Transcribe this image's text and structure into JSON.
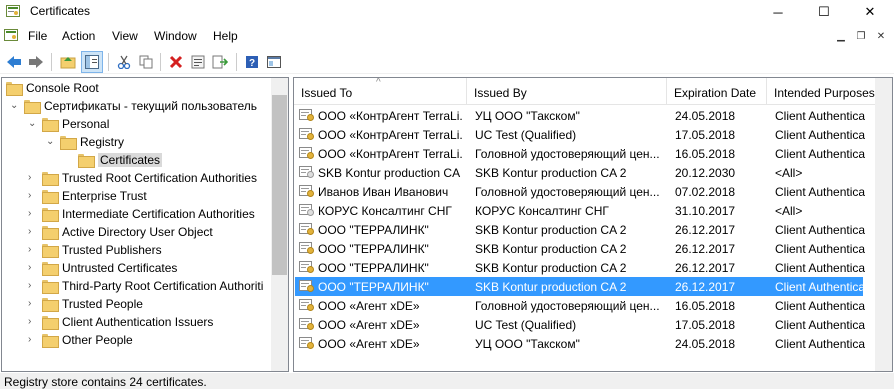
{
  "window": {
    "title": "Certificates",
    "minimize": "─",
    "maximize": "☐",
    "close": "✕"
  },
  "menu": {
    "items": [
      "File",
      "Action",
      "View",
      "Window",
      "Help"
    ],
    "mdi": [
      "▁",
      "❐",
      "✕"
    ]
  },
  "toolbar": {
    "icons": [
      "back-icon",
      "forward-icon",
      "up-folder-icon",
      "show-hide-tree-icon",
      "cut-icon",
      "copy-icon",
      "delete-icon",
      "properties-icon",
      "export-list-icon",
      "help-icon",
      "mmc-icon"
    ]
  },
  "tree": {
    "nodes": [
      {
        "label": "Console Root",
        "level": 0,
        "expanded": null
      },
      {
        "label": "Сертификаты - текущий пользователь",
        "level": 1,
        "expanded": true
      },
      {
        "label": "Personal",
        "level": 2,
        "expanded": true
      },
      {
        "label": "Registry",
        "level": 3,
        "expanded": true
      },
      {
        "label": "Certificates",
        "level": 4,
        "expanded": null,
        "selected": true
      },
      {
        "label": "Trusted Root Certification Authorities",
        "level": 2,
        "expanded": false
      },
      {
        "label": "Enterprise Trust",
        "level": 2,
        "expanded": false
      },
      {
        "label": "Intermediate Certification Authorities",
        "level": 2,
        "expanded": false
      },
      {
        "label": "Active Directory User Object",
        "level": 2,
        "expanded": false
      },
      {
        "label": "Trusted Publishers",
        "level": 2,
        "expanded": false
      },
      {
        "label": "Untrusted Certificates",
        "level": 2,
        "expanded": false
      },
      {
        "label": "Third-Party Root Certification Authoriti",
        "level": 2,
        "expanded": false
      },
      {
        "label": "Trusted People",
        "level": 2,
        "expanded": false
      },
      {
        "label": "Client Authentication Issuers",
        "level": 2,
        "expanded": false
      },
      {
        "label": "Other People",
        "level": 2,
        "expanded": false
      }
    ]
  },
  "list": {
    "columns": [
      "Issued To",
      "Issued By",
      "Expiration Date",
      "Intended Purposes"
    ],
    "sort_indicator": "^",
    "rows": [
      {
        "issued_to": "ООО «КонтрАгент TerraLi...",
        "issued_by": "УЦ ООО \"Такском\"",
        "expiration": "24.05.2018",
        "purposes": "Client Authenticati"
      },
      {
        "issued_to": "ООО «КонтрАгент TerraLi...",
        "issued_by": "UC Test (Qualified)",
        "expiration": "17.05.2018",
        "purposes": "Client Authenticati"
      },
      {
        "issued_to": "ООО «КонтрАгент TerraLi...",
        "issued_by": "Головной удостоверяющий цен...",
        "expiration": "16.05.2018",
        "purposes": "Client Authenticati"
      },
      {
        "issued_to": "SKB Kontur production CA 2",
        "issued_by": "SKB Kontur production CA 2",
        "expiration": "20.12.2030",
        "purposes": "<All>"
      },
      {
        "issued_to": "Иванов Иван Иванович",
        "issued_by": "Головной удостоверяющий цен...",
        "expiration": "07.02.2018",
        "purposes": "Client Authenticati"
      },
      {
        "issued_to": "КОРУС Консалтинг СНГ",
        "issued_by": "КОРУС Консалтинг СНГ",
        "expiration": "31.10.2017",
        "purposes": "<All>"
      },
      {
        "issued_to": "ООО \"ТЕРРАЛИНК\"",
        "issued_by": "SKB Kontur production CA 2",
        "expiration": "26.12.2017",
        "purposes": "Client Authenticati"
      },
      {
        "issued_to": "ООО \"ТЕРРАЛИНК\"",
        "issued_by": "SKB Kontur production CA 2",
        "expiration": "26.12.2017",
        "purposes": "Client Authenticati"
      },
      {
        "issued_to": "ООО \"ТЕРРАЛИНК\"",
        "issued_by": "SKB Kontur production CA 2",
        "expiration": "26.12.2017",
        "purposes": "Client Authenticati"
      },
      {
        "issued_to": "ООО \"ТЕРРАЛИНК\"",
        "issued_by": "SKB Kontur production CA 2",
        "expiration": "26.12.2017",
        "purposes": "Client Authenticati",
        "selected": true
      },
      {
        "issued_to": "ООО «Агент xDE»",
        "issued_by": "Головной удостоверяющий цен...",
        "expiration": "16.05.2018",
        "purposes": "Client Authenticati"
      },
      {
        "issued_to": "ООО «Агент xDE»",
        "issued_by": "UC Test (Qualified)",
        "expiration": "17.05.2018",
        "purposes": "Client Authenticati"
      },
      {
        "issued_to": "ООО «Агент xDE»",
        "issued_by": "УЦ ООО \"Такском\"",
        "expiration": "24.05.2018",
        "purposes": "Client Authenticati"
      }
    ]
  },
  "status": {
    "text": "Registry store contains 24 certificates."
  },
  "colors": {
    "selection": "#3399ff",
    "folder": "#f4cf6e"
  }
}
